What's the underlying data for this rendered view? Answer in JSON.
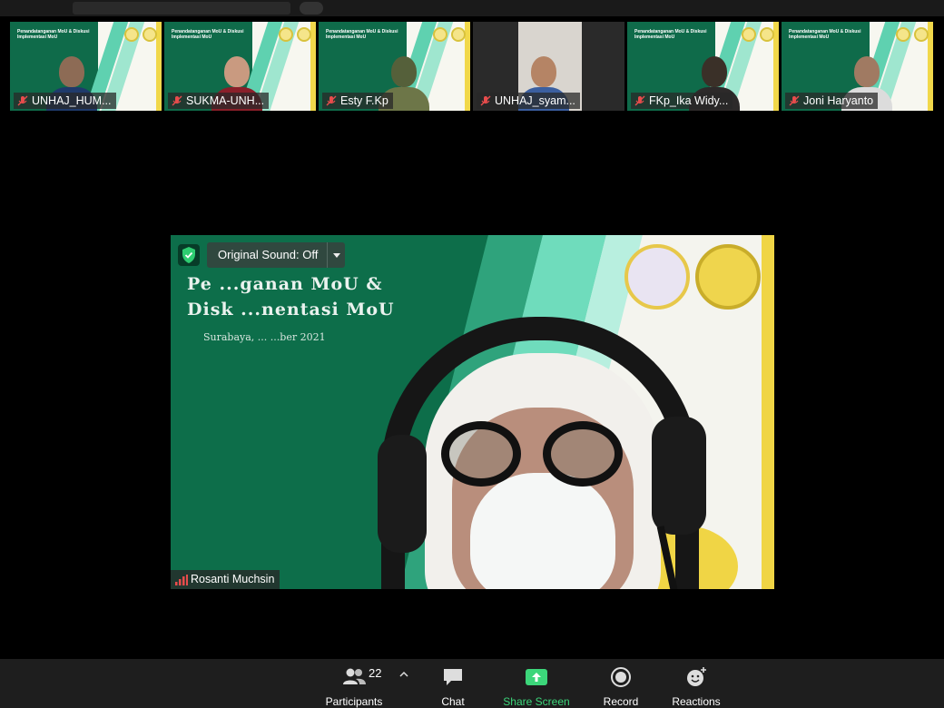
{
  "meeting": {
    "participants_count": "22"
  },
  "gallery": [
    {
      "name": "UNHAJ_HUM...",
      "muted": true,
      "slide_title": "Penandatanganan MoU & Diskusi Implementasi MoU"
    },
    {
      "name": "SUKMA-UNH...",
      "muted": true,
      "slide_title": "Penandatanganan MoU & Diskusi Implementasi MoU"
    },
    {
      "name": "Esty F.Kp",
      "muted": true,
      "slide_title": "Penandatanganan MoU & Diskusi Implementasi MoU"
    },
    {
      "name": "UNHAJ_syam...",
      "muted": true,
      "slide_title": ""
    },
    {
      "name": "FKp_Ika Widy...",
      "muted": true,
      "slide_title": "Penandatanganan MoU & Diskusi Implementasi MoU"
    },
    {
      "name": "Joni Haryanto",
      "muted": true,
      "slide_title": "Penandatanganan MoU & Diskusi Implementasi MoU"
    }
  ],
  "active_speaker": {
    "name": "Rosanti Muchsin",
    "original_sound": "Original Sound: Off",
    "slide_title_line1": "Pe      ...ganan MoU &",
    "slide_title_line2": "Disk        ...nentasi MoU",
    "slide_subtitle": "Surabaya, ...        ...ber 2021"
  },
  "toolbar": {
    "participants_label": "Participants",
    "chat_label": "Chat",
    "share_label": "Share Screen",
    "record_label": "Record",
    "reactions_label": "Reactions"
  },
  "colors": {
    "share_green": "#3cd67a",
    "slide_green": "#0d6e4a",
    "slide_yellow": "#f0d545"
  }
}
